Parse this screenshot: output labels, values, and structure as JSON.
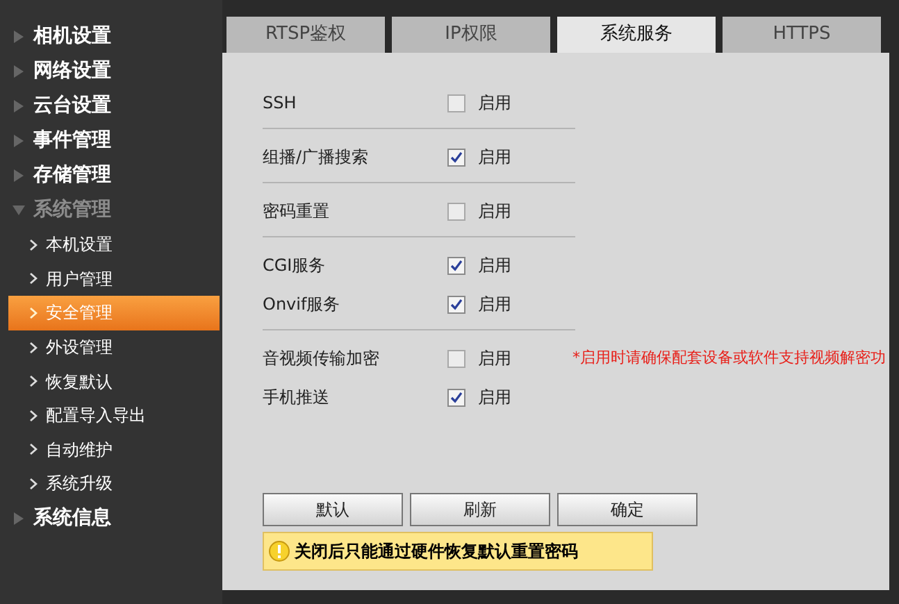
{
  "sidebar": {
    "items": [
      {
        "label": "相机设置",
        "expanded": false
      },
      {
        "label": "网络设置",
        "expanded": false
      },
      {
        "label": "云台设置",
        "expanded": false
      },
      {
        "label": "事件管理",
        "expanded": false
      },
      {
        "label": "存储管理",
        "expanded": false
      },
      {
        "label": "系统管理",
        "expanded": true,
        "children": [
          {
            "label": "本机设置",
            "selected": false
          },
          {
            "label": "用户管理",
            "selected": false
          },
          {
            "label": "安全管理",
            "selected": true
          },
          {
            "label": "外设管理",
            "selected": false
          },
          {
            "label": "恢复默认",
            "selected": false
          },
          {
            "label": "配置导入导出",
            "selected": false
          },
          {
            "label": "自动维护",
            "selected": false
          },
          {
            "label": "系统升级",
            "selected": false
          }
        ]
      },
      {
        "label": "系统信息",
        "expanded": false
      }
    ]
  },
  "tabs": [
    {
      "label": "RTSP鉴权",
      "selected": false
    },
    {
      "label": "IP权限",
      "selected": false
    },
    {
      "label": "系统服务",
      "selected": true
    },
    {
      "label": "HTTPS",
      "selected": false
    }
  ],
  "groups": [
    [
      {
        "label": "SSH",
        "checked": false,
        "option": "启用"
      }
    ],
    [
      {
        "label": "组播/广播搜索",
        "checked": true,
        "option": "启用"
      }
    ],
    [
      {
        "label": "密码重置",
        "checked": false,
        "option": "启用"
      }
    ],
    [
      {
        "label": "CGI服务",
        "checked": true,
        "option": "启用"
      },
      {
        "label": "Onvif服务",
        "checked": true,
        "option": "启用"
      }
    ],
    [
      {
        "label": "音视频传输加密",
        "checked": false,
        "option": "启用",
        "note": "*启用时请确保配套设备或软件支持视频解密功"
      },
      {
        "label": "手机推送",
        "checked": true,
        "option": "启用"
      }
    ]
  ],
  "buttons": [
    "默认",
    "刷新",
    "确定"
  ],
  "warning": "关闭后只能通过硬件恢复默认重置密码"
}
